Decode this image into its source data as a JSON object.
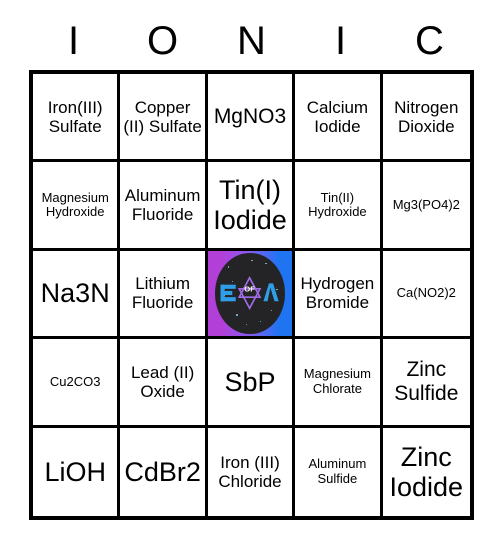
{
  "card": {
    "title_letters": [
      "I",
      "O",
      "N",
      "I",
      "C"
    ],
    "grid_size": "5x5",
    "cells": [
      {
        "text": "Iron(III) Sulfate",
        "size": "md",
        "type": "text"
      },
      {
        "text": "Copper (II) Sulfate",
        "size": "md",
        "type": "text"
      },
      {
        "text": "MgNO3",
        "size": "lg",
        "type": "text"
      },
      {
        "text": "Calcium Iodide",
        "size": "md",
        "type": "text"
      },
      {
        "text": "Nitrogen Dioxide",
        "size": "md",
        "type": "text"
      },
      {
        "text": "Magnesium Hydroxide",
        "size": "sm",
        "type": "text"
      },
      {
        "text": "Aluminum Fluoride",
        "size": "md",
        "type": "text"
      },
      {
        "text": "Tin(I) Iodide",
        "size": "xl",
        "type": "text"
      },
      {
        "text": "Tin(II) Hydroxide",
        "size": "sm",
        "type": "text"
      },
      {
        "text": "Mg3(PO4)2",
        "size": "sm",
        "type": "text"
      },
      {
        "text": "Na3N",
        "size": "xl",
        "type": "text"
      },
      {
        "text": "Lithium Fluoride",
        "size": "md",
        "type": "text"
      },
      {
        "text": "",
        "size": "md",
        "type": "free-space-logo"
      },
      {
        "text": "Hydrogen Bromide",
        "size": "md",
        "type": "text"
      },
      {
        "text": "Ca(NO2)2",
        "size": "sm",
        "type": "text"
      },
      {
        "text": "Cu2CO3",
        "size": "sm",
        "type": "text"
      },
      {
        "text": "Lead (II) Oxide",
        "size": "md",
        "type": "text"
      },
      {
        "text": "SbP",
        "size": "xl",
        "type": "text"
      },
      {
        "text": "Magnesium Chlorate",
        "size": "sm",
        "type": "text"
      },
      {
        "text": "Zinc Sulfide",
        "size": "lg",
        "type": "text"
      },
      {
        "text": "LiOH",
        "size": "xl",
        "type": "text"
      },
      {
        "text": "CdBr2",
        "size": "xl",
        "type": "text"
      },
      {
        "text": "Iron (III) Chloride",
        "size": "md",
        "type": "text"
      },
      {
        "text": "Aluminum Sulfide",
        "size": "sm",
        "type": "text"
      },
      {
        "text": "Zinc Iodide",
        "size": "xl",
        "type": "text"
      }
    ],
    "free_space": {
      "icon_name": "free-space-logo",
      "left_letter": "E",
      "center_text": "OF",
      "right_letter": "A",
      "gradient_start": "#b23fd8",
      "gradient_mid": "#8a5af0",
      "gradient_end": "#1f74f2",
      "disc_color": "#242427",
      "letter_color": "#2f9de8",
      "star_color": "#a06ce8"
    },
    "colors": {
      "border": "#000000",
      "cell_background": "#ffffff",
      "text": "#000000",
      "page_background": "#ffffff"
    }
  }
}
